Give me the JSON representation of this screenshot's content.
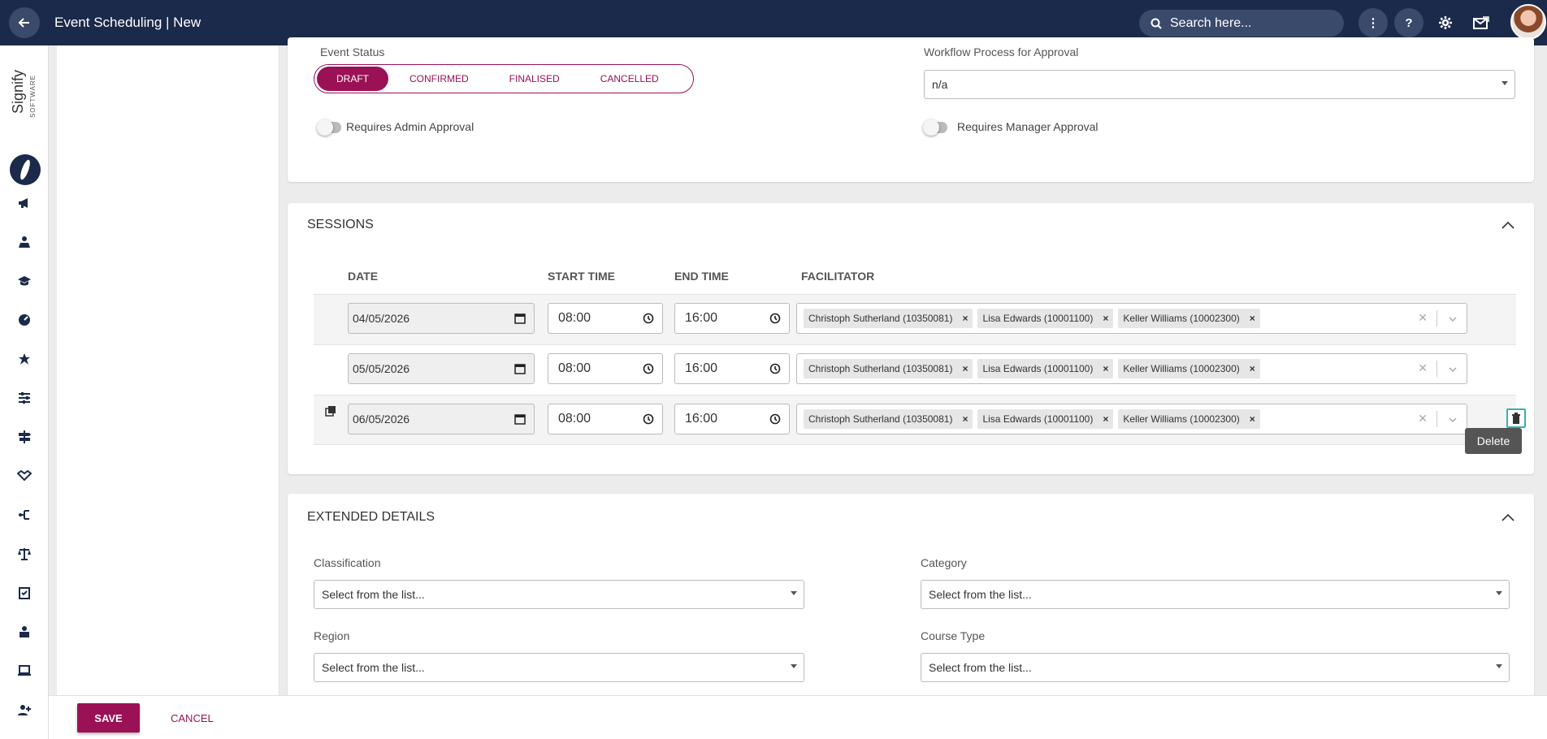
{
  "header": {
    "title": "Event Scheduling | New",
    "search_placeholder": "Search here..."
  },
  "logo": {
    "name": "Signify",
    "sub": "SOFTWARE"
  },
  "event_status": {
    "label": "Event Status",
    "options": [
      "DRAFT",
      "CONFIRMED",
      "FINALISED",
      "CANCELLED"
    ],
    "selected": "DRAFT"
  },
  "workflow": {
    "label": "Workflow Process for Approval",
    "value": "n/a"
  },
  "toggles": {
    "admin_approval": "Requires Admin Approval",
    "manager_approval": "Requires Manager Approval"
  },
  "sessions": {
    "title": "SESSIONS",
    "columns": [
      "DATE",
      "START TIME",
      "END TIME",
      "FACILITATOR"
    ],
    "rows": [
      {
        "date": "04/05/2026",
        "start": "08:00",
        "end": "16:00",
        "facilitators": [
          "Christoph Sutherland (10350081)",
          "Lisa Edwards (10001100)",
          "Keller Williams (10002300)"
        ]
      },
      {
        "date": "05/05/2026",
        "start": "08:00",
        "end": "16:00",
        "facilitators": [
          "Christoph Sutherland (10350081)",
          "Lisa Edwards (10001100)",
          "Keller Williams (10002300)"
        ]
      },
      {
        "date": "06/05/2026",
        "start": "08:00",
        "end": "16:00",
        "facilitators": [
          "Christoph Sutherland (10350081)",
          "Lisa Edwards (10001100)",
          "Keller Williams (10002300)"
        ]
      }
    ],
    "delete_tooltip": "Delete"
  },
  "extended": {
    "title": "EXTENDED DETAILS",
    "fields": [
      {
        "label": "Classification",
        "value": "Select from the list..."
      },
      {
        "label": "Category",
        "value": "Select from the list..."
      },
      {
        "label": "Region",
        "value": "Select from the list..."
      },
      {
        "label": "Course Type",
        "value": "Select from the list..."
      }
    ]
  },
  "footer": {
    "save": "SAVE",
    "cancel": "CANCEL"
  },
  "colors": {
    "brand": "#9b1155",
    "topbar": "#1b2a4a",
    "accent": "#3ab0b0"
  }
}
